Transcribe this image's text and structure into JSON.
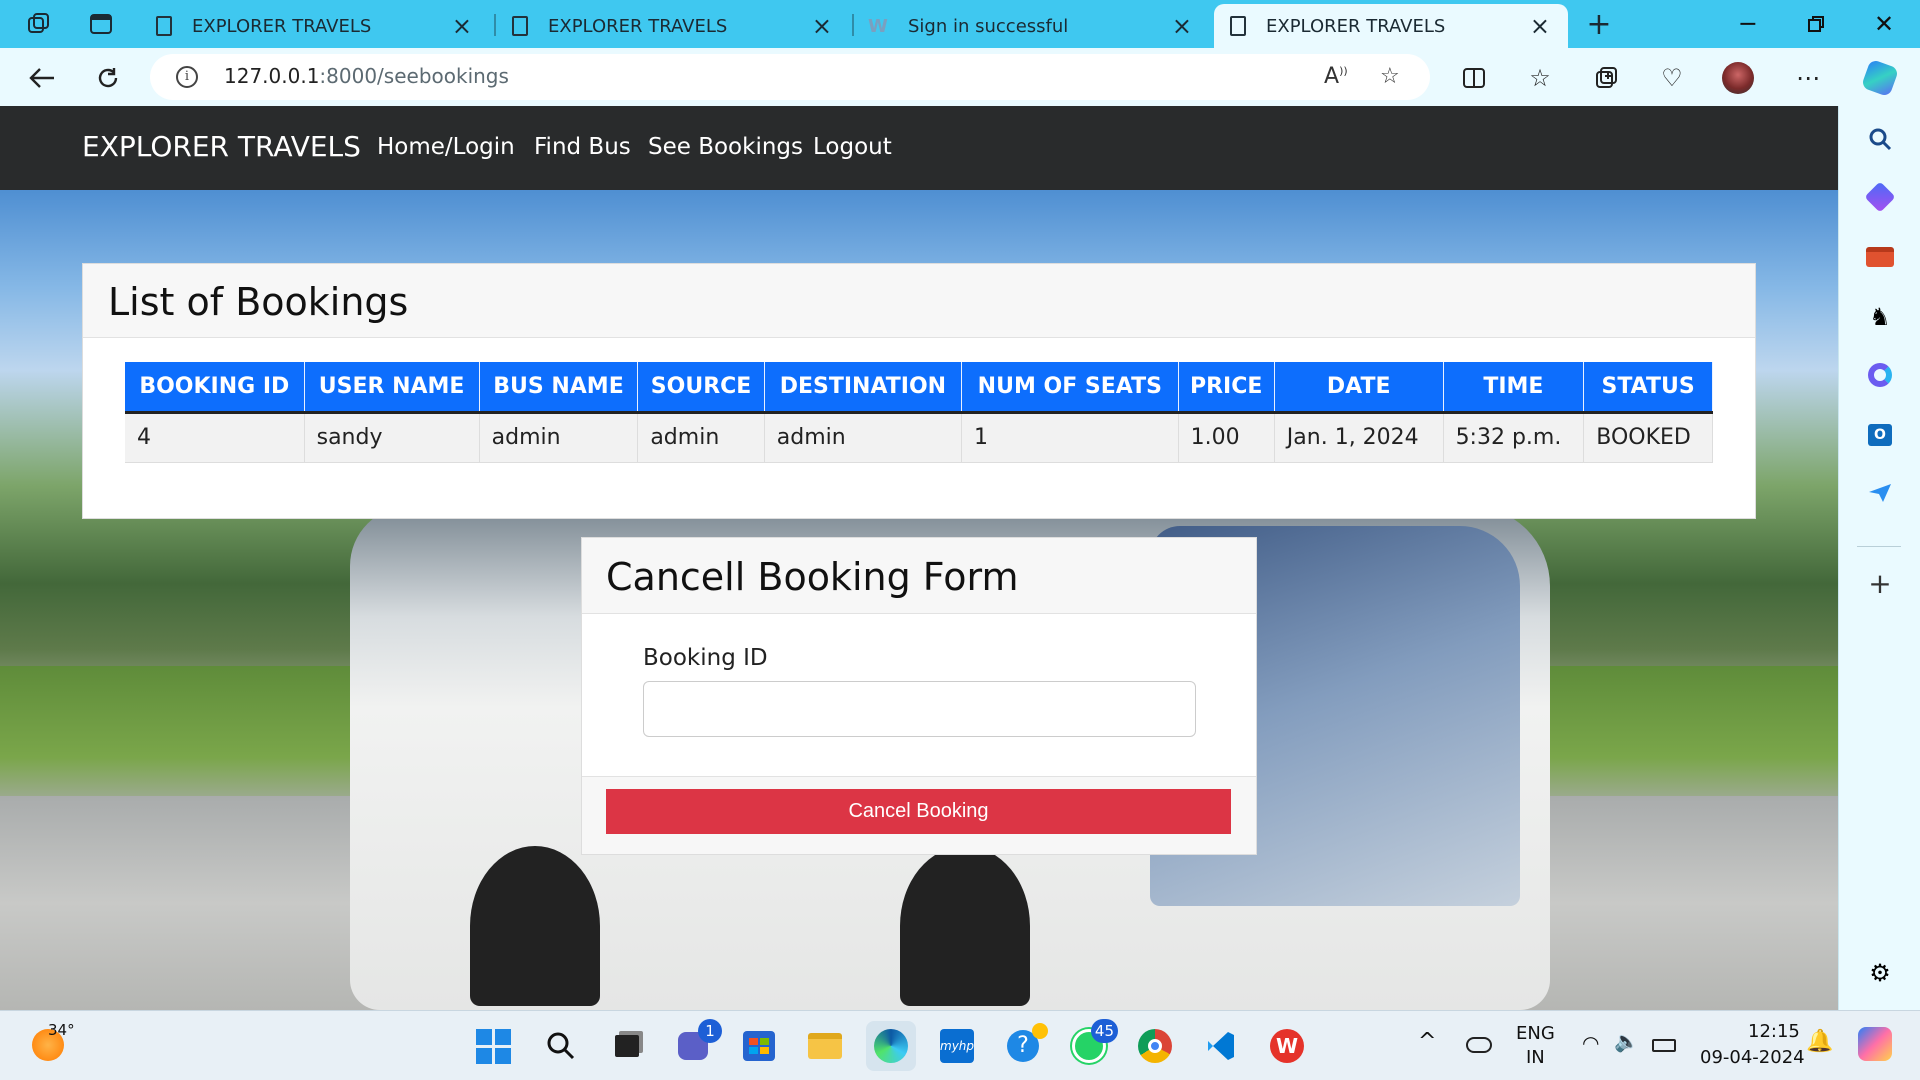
{
  "browser": {
    "tabs": [
      {
        "title": "EXPLORER TRAVELS",
        "active": false
      },
      {
        "title": "EXPLORER TRAVELS",
        "active": false
      },
      {
        "title": "Sign in successful",
        "active": false
      },
      {
        "title": "EXPLORER TRAVELS",
        "active": true
      }
    ],
    "url_host": "127.0.0.1",
    "url_path": ":8000/seebookings",
    "colors": {
      "tab_strip": "#3fc8f0",
      "toolbar": "#eafaff"
    }
  },
  "navbar": {
    "brand": "EXPLORER TRAVELS",
    "links": [
      "Home/Login",
      "Find Bus",
      "See Bookings",
      "Logout"
    ]
  },
  "bookings": {
    "title": "List of Bookings",
    "columns": [
      "BOOKING ID",
      "USER NAME",
      "BUS NAME",
      "SOURCE",
      "DESTINATION",
      "NUM OF SEATS",
      "PRICE",
      "DATE",
      "TIME",
      "STATUS"
    ],
    "rows": [
      [
        "4",
        "sandy",
        "admin",
        "admin",
        "admin",
        "1",
        "1.00",
        "Jan. 1, 2024",
        "5:32 p.m.",
        "BOOKED"
      ]
    ]
  },
  "cancel_form": {
    "title": "Cancell Booking Form",
    "field_label": "Booking ID",
    "field_value": "",
    "submit_label": "Cancel Booking",
    "colors": {
      "button": "#dc3545",
      "table_header": "#0d6efd"
    }
  },
  "taskbar": {
    "weather": "34°",
    "teams_badge": "1",
    "whatsapp_badge": "45",
    "lang_line1": "ENG",
    "lang_line2": "IN",
    "time": "12:15",
    "date": "09-04-2024",
    "apps": [
      "windows-start",
      "search",
      "task-view",
      "teams",
      "microsoft-store",
      "file-explorer",
      "edge",
      "myhp",
      "tips",
      "whatsapp",
      "chrome",
      "vscode",
      "wps-office"
    ]
  }
}
